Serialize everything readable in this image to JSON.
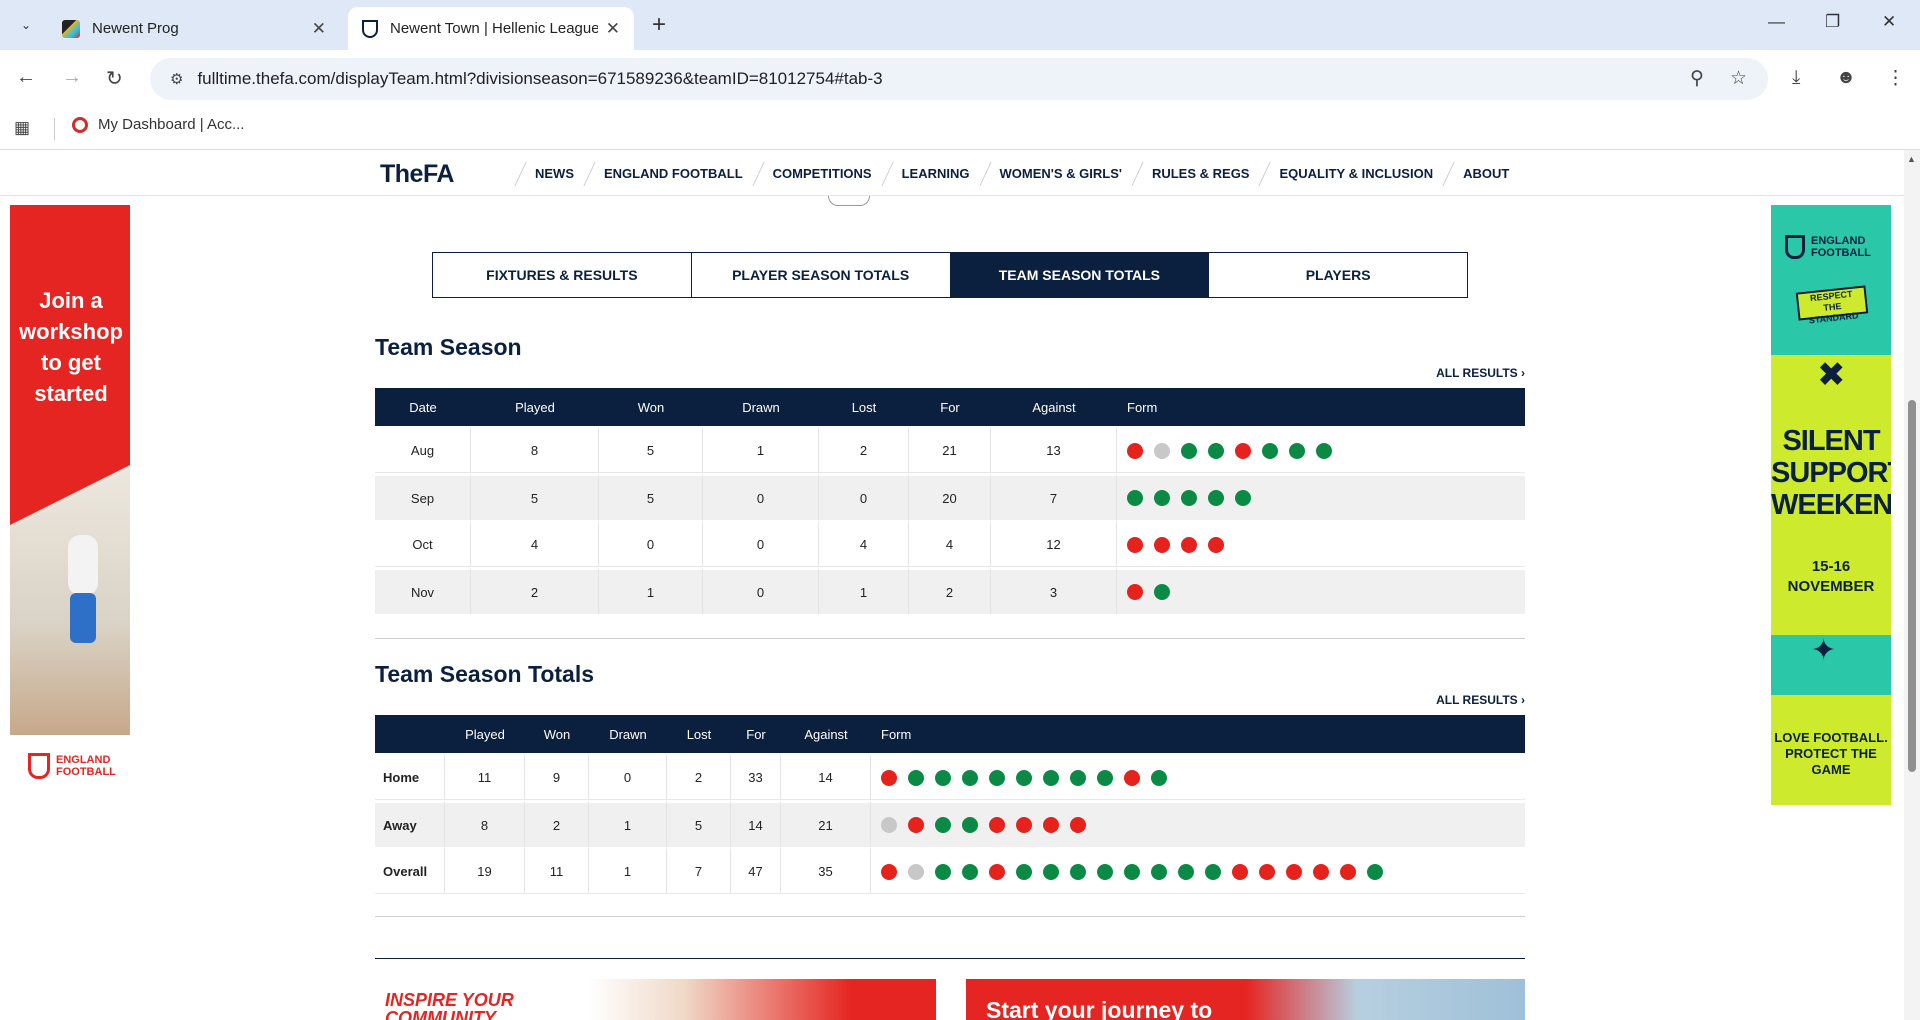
{
  "browser": {
    "tabs": [
      {
        "title": "Newent Prog",
        "active": false
      },
      {
        "title": "Newent Town | Hellenic League",
        "active": true
      }
    ],
    "url": "fulltime.thefa.com/displayTeam.html?divisionseason=671589236&teamID=81012754#tab-3",
    "bookmark": "My Dashboard | Acc..."
  },
  "site": {
    "logo": "TheFA",
    "nav": [
      "NEWS",
      "ENGLAND FOOTBALL",
      "COMPETITIONS",
      "LEARNING",
      "WOMEN'S & GIRLS'",
      "RULES & REGS",
      "EQUALITY & INCLUSION",
      "ABOUT"
    ]
  },
  "ads": {
    "left": {
      "text": "Join a workshop to get started",
      "brand_line1": "ENGLAND",
      "brand_line2": "FOOTBALL"
    },
    "right": {
      "brand_line1": "ENGLAND",
      "brand_line2": "FOOTBALL",
      "respect_line1": "RESPECT",
      "respect_line2": "THE STANDARD",
      "headline_1": "SILENT",
      "headline_2": "SUPPORT",
      "headline_3": "WEEKEND",
      "dates_1": "15-16",
      "dates_2": "NOVEMBER",
      "tagline_1": "LOVE FOOTBALL.",
      "tagline_2": "PROTECT THE GAME"
    }
  },
  "team_tabs": [
    {
      "label": "FIXTURES & RESULTS",
      "active": false
    },
    {
      "label": "PLAYER SEASON TOTALS",
      "active": false
    },
    {
      "label": "TEAM SEASON TOTALS",
      "active": true
    },
    {
      "label": "PLAYERS",
      "active": false
    }
  ],
  "team_season": {
    "title": "Team Season",
    "all_results": "ALL RESULTS",
    "headers": [
      "Date",
      "Played",
      "Won",
      "Drawn",
      "Lost",
      "For",
      "Against",
      "Form"
    ],
    "rows": [
      {
        "date": "Aug",
        "played": "8",
        "won": "5",
        "drawn": "1",
        "lost": "2",
        "for": "21",
        "against": "13",
        "form": [
          "L",
          "D",
          "W",
          "W",
          "L",
          "W",
          "W",
          "W"
        ]
      },
      {
        "date": "Sep",
        "played": "5",
        "won": "5",
        "drawn": "0",
        "lost": "0",
        "for": "20",
        "against": "7",
        "form": [
          "W",
          "W",
          "W",
          "W",
          "W"
        ]
      },
      {
        "date": "Oct",
        "played": "4",
        "won": "0",
        "drawn": "0",
        "lost": "4",
        "for": "4",
        "against": "12",
        "form": [
          "L",
          "L",
          "L",
          "L"
        ]
      },
      {
        "date": "Nov",
        "played": "2",
        "won": "1",
        "drawn": "0",
        "lost": "1",
        "for": "2",
        "against": "3",
        "form": [
          "L",
          "W"
        ]
      }
    ]
  },
  "team_season_totals": {
    "title": "Team Season Totals",
    "all_results": "ALL RESULTS",
    "headers": [
      "",
      "Played",
      "Won",
      "Drawn",
      "Lost",
      "For",
      "Against",
      "Form"
    ],
    "rows": [
      {
        "label": "Home",
        "played": "11",
        "won": "9",
        "drawn": "0",
        "lost": "2",
        "for": "33",
        "against": "14",
        "form": [
          "L",
          "W",
          "W",
          "W",
          "W",
          "W",
          "W",
          "W",
          "W",
          "L",
          "W"
        ]
      },
      {
        "label": "Away",
        "played": "8",
        "won": "2",
        "drawn": "1",
        "lost": "5",
        "for": "14",
        "against": "21",
        "form": [
          "D",
          "L",
          "W",
          "W",
          "L",
          "L",
          "L",
          "L"
        ]
      },
      {
        "label": "Overall",
        "played": "19",
        "won": "11",
        "drawn": "1",
        "lost": "7",
        "for": "47",
        "against": "35",
        "form": [
          "L",
          "D",
          "W",
          "W",
          "L",
          "W",
          "W",
          "W",
          "W",
          "W",
          "W",
          "W",
          "W",
          "L",
          "L",
          "L",
          "L",
          "L",
          "W"
        ]
      }
    ]
  },
  "promos": {
    "left_line1": "INSPIRE YOUR",
    "left_line2": "COMMUNITY",
    "right": "Start your journey to"
  },
  "colors": {
    "navy": "#0b1f3e",
    "win": "#0a8a45",
    "loss": "#e5221b",
    "draw": "#c8c8c8"
  }
}
